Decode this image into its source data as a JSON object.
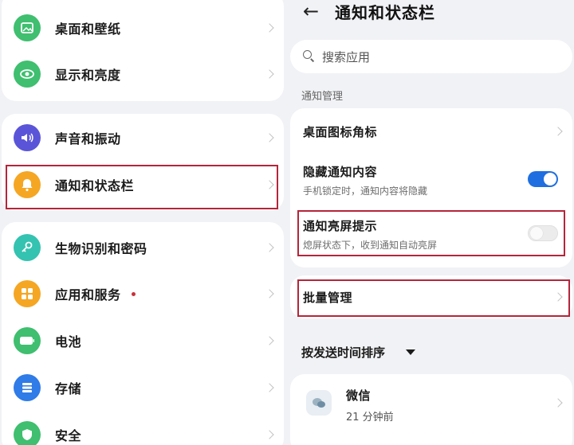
{
  "left": {
    "items": [
      {
        "label": "桌面和壁纸",
        "icon": "wallpaper-icon",
        "color": "#3fbf6f"
      },
      {
        "label": "显示和亮度",
        "icon": "eye-icon",
        "color": "#3fbf6f"
      },
      {
        "label": "声音和振动",
        "icon": "speaker-icon",
        "color": "#5a55d8"
      },
      {
        "label": "通知和状态栏",
        "icon": "bell-icon",
        "color": "#f5a623"
      },
      {
        "label": "生物识别和密码",
        "icon": "key-icon",
        "color": "#34c3b0"
      },
      {
        "label": "应用和服务",
        "icon": "apps-grid-icon",
        "color": "#f5a623"
      },
      {
        "label": "电池",
        "icon": "battery-icon",
        "color": "#3fbf6f"
      },
      {
        "label": "存储",
        "icon": "storage-icon",
        "color": "#2f7be8"
      },
      {
        "label": "安全",
        "icon": "shield-icon",
        "color": "#3fbf6f"
      }
    ]
  },
  "right": {
    "back_icon": "back-arrow-icon",
    "title": "通知和状态栏",
    "search_placeholder": "搜索应用",
    "section_label": "通知管理",
    "rows": {
      "badge": {
        "title": "桌面图标角标"
      },
      "hide_content": {
        "title": "隐藏通知内容",
        "subtitle": "手机锁定时，通知内容将隐藏",
        "enabled": true
      },
      "wake_screen": {
        "title": "通知亮屏提示",
        "subtitle": "熄屏状态下，收到通知自动亮屏",
        "enabled": false
      },
      "batch": {
        "title": "批量管理"
      }
    },
    "sort_label": "按发送时间排序",
    "apps": [
      {
        "name": "微信",
        "time": "21 分钟前",
        "icon": "wechat-icon"
      }
    ]
  },
  "colors": {
    "accent": "#1f6fe0",
    "highlight": "#b5253a",
    "background": "#f1f2f5"
  }
}
